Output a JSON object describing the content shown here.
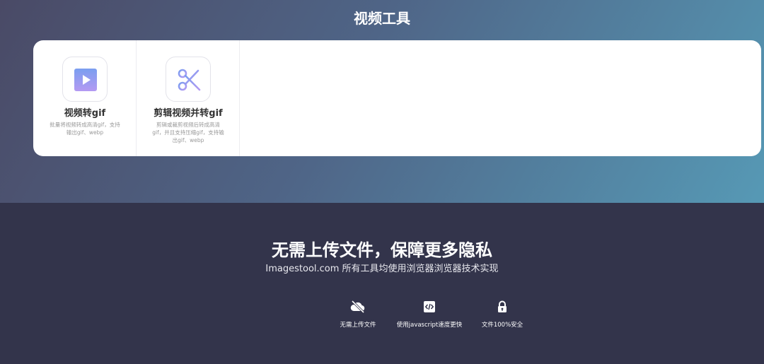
{
  "section": {
    "title": "视频工具"
  },
  "tools": [
    {
      "name": "视频转gif",
      "desc": "批量将视频转成高清gif，支持输出gif、webp",
      "icon": "play-icon"
    },
    {
      "name": "剪辑视频并转gif",
      "desc": "剪辑或裁剪视频后转成高清gif，并且支持压缩gif，支持输出gif、webp",
      "icon": "scissors-icon"
    }
  ],
  "privacy": {
    "title": "无需上传文件，保障更多隐私",
    "subtitle": "Imagestool.com 所有工具均使用浏览器浏览器技术实现",
    "features": [
      {
        "label": "无需上传文件",
        "icon": "cloud-off-icon"
      },
      {
        "label": "使用javascript速度更快",
        "icon": "code-icon"
      },
      {
        "label": "文件100%安全",
        "icon": "lock-icon"
      }
    ]
  },
  "colors": {
    "accent_start": "#7a9ef0",
    "accent_end": "#b39af0",
    "dark_bg": "#33344b"
  }
}
